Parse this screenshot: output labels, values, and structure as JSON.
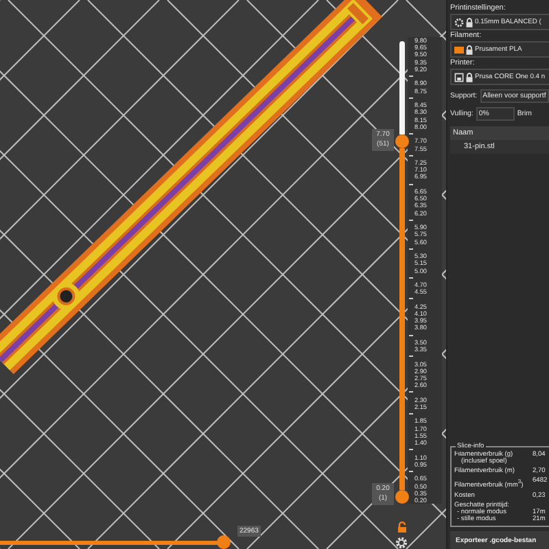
{
  "layer_slider": {
    "level": 0.78,
    "upper_value": "7.70",
    "upper_layer": "(51)",
    "lower_value": "0.20",
    "lower_layer": "(1)",
    "ticks": [
      {
        "label": "9.80"
      },
      {
        "label": "9.65"
      },
      {
        "label": "9.50"
      },
      {
        "label": "9.35"
      },
      {
        "label": "9.20"
      },
      {
        "kind": "mark"
      },
      {
        "label": "8.90"
      },
      {
        "label": "8.75"
      },
      {
        "kind": "mark"
      },
      {
        "label": "8.45"
      },
      {
        "label": "8.30"
      },
      {
        "label": "8.15"
      },
      {
        "label": "8.00"
      },
      {
        "kind": "mark"
      },
      {
        "label": "7.70"
      },
      {
        "label": "7.55"
      },
      {
        "kind": "mark"
      },
      {
        "label": "7.25"
      },
      {
        "label": "7.10"
      },
      {
        "label": "6.95"
      },
      {
        "kind": "mark"
      },
      {
        "label": "6.65"
      },
      {
        "label": "6.50"
      },
      {
        "label": "6.35"
      },
      {
        "label": "6.20"
      },
      {
        "kind": "mark"
      },
      {
        "label": "5.90"
      },
      {
        "label": "5.75"
      },
      {
        "label": "5.60"
      },
      {
        "kind": "mark"
      },
      {
        "label": "5.30"
      },
      {
        "label": "5.15"
      },
      {
        "label": "5.00"
      },
      {
        "kind": "mark"
      },
      {
        "label": "4.70"
      },
      {
        "label": "4.55"
      },
      {
        "kind": "mark"
      },
      {
        "label": "4.25"
      },
      {
        "label": "4.10"
      },
      {
        "label": "3.95"
      },
      {
        "label": "3.80"
      },
      {
        "kind": "mark"
      },
      {
        "label": "3.50"
      },
      {
        "label": "3.35"
      },
      {
        "kind": "mark"
      },
      {
        "label": "3.05"
      },
      {
        "label": "2.90"
      },
      {
        "label": "2.75"
      },
      {
        "label": "2.60"
      },
      {
        "kind": "mark"
      },
      {
        "label": "2.30"
      },
      {
        "label": "2.15"
      },
      {
        "kind": "mark"
      },
      {
        "label": "1.85"
      },
      {
        "label": "1.70"
      },
      {
        "label": "1.55"
      },
      {
        "label": "1.40"
      },
      {
        "kind": "mark"
      },
      {
        "label": "1.10"
      },
      {
        "label": "0.95"
      },
      {
        "kind": "mark"
      },
      {
        "label": "0.65"
      },
      {
        "label": "0.50"
      },
      {
        "label": "0.35"
      },
      {
        "label": "0.20"
      }
    ]
  },
  "move_slider": {
    "level": 0.5,
    "value": "22963"
  },
  "sidebar": {
    "print_settings": {
      "label": "Printinstellingen:",
      "value": "0.15mm BALANCED ("
    },
    "filament": {
      "label": "Filament:",
      "value": "Prusament PLA",
      "color": "#f07f16"
    },
    "printer": {
      "label": "Printer:",
      "value": "Prusa CORE One 0.4 n"
    },
    "support": {
      "label": "Support:",
      "value": "Alleen voor supportf"
    },
    "infill": {
      "label": "Vulling:",
      "value": "0%"
    },
    "brim": {
      "label": "Brim"
    },
    "objects": {
      "header": "Naam",
      "rows": [
        "31-pin.stl"
      ]
    },
    "slice_info": {
      "title": "Slice-info",
      "rows": [
        {
          "label": "Filamentverbruik (g)",
          "sub": "(inclusief spoel)",
          "value": "8,04"
        },
        {
          "label": "Filamentverbruik (m)",
          "value": "2,70"
        },
        {
          "label": "Filamentverbruik (mm$^{3}$)",
          "value": "6482"
        },
        {
          "label": "Kosten",
          "value": "0,23"
        }
      ],
      "time_title": "Geschatte printtijd:",
      "times": [
        {
          "label": "- normale modus",
          "value": "17m"
        },
        {
          "label": "- stille modus",
          "value": "21m"
        }
      ]
    },
    "export_button": "Exporteer .gcode-bestan"
  }
}
